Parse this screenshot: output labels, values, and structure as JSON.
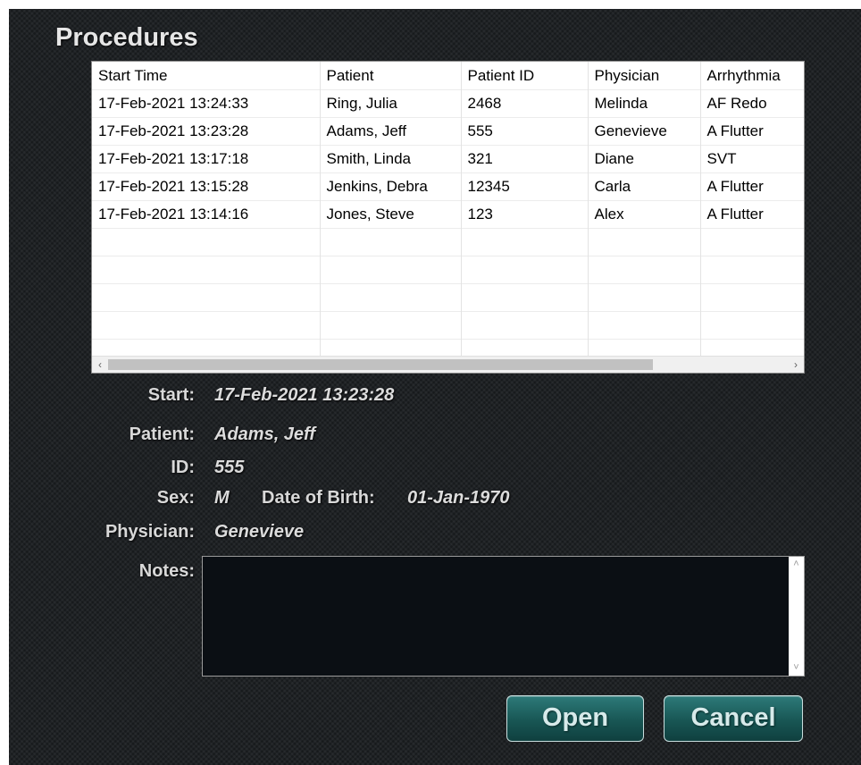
{
  "dialog": {
    "title": "Procedures"
  },
  "table": {
    "columns": [
      "Start Time",
      "Patient",
      "Patient ID",
      "Physician",
      "Arrhythmia"
    ],
    "rows": [
      [
        "17-Feb-2021 13:24:33",
        "Ring, Julia",
        "2468",
        "Melinda",
        "AF Redo"
      ],
      [
        "17-Feb-2021 13:23:28",
        "Adams, Jeff",
        "555",
        "Genevieve",
        "A Flutter"
      ],
      [
        "17-Feb-2021 13:17:18",
        "Smith, Linda",
        "321",
        "Diane",
        "SVT"
      ],
      [
        "17-Feb-2021 13:15:28",
        "Jenkins, Debra",
        "12345",
        "Carla",
        "A Flutter"
      ],
      [
        "17-Feb-2021 13:14:16",
        "Jones, Steve",
        "123",
        "Alex",
        "A Flutter"
      ],
      [
        "",
        "",
        "",
        "",
        ""
      ],
      [
        "",
        "",
        "",
        "",
        ""
      ],
      [
        "",
        "",
        "",
        "",
        ""
      ],
      [
        "",
        "",
        "",
        "",
        ""
      ],
      [
        "",
        "",
        "",
        "",
        ""
      ]
    ],
    "scroll_left_glyph": "‹",
    "scroll_right_glyph": "›"
  },
  "details": {
    "start_label": "Start:",
    "start_value": "17-Feb-2021 13:23:28",
    "patient_label": "Patient:",
    "patient_value": "Adams, Jeff",
    "id_label": "ID:",
    "id_value": "555",
    "sex_label": "Sex:",
    "sex_value": "M",
    "dob_label": "Date of Birth:",
    "dob_value": "01-Jan-1970",
    "physician_label": "Physician:",
    "physician_value": "Genevieve",
    "notes_label": "Notes:",
    "notes_value": ""
  },
  "notes_scroll": {
    "up_glyph": "˄",
    "down_glyph": "˅"
  },
  "buttons": {
    "open": "Open",
    "cancel": "Cancel"
  },
  "colors": {
    "button_teal": "#185654",
    "background": "#1f2225"
  }
}
